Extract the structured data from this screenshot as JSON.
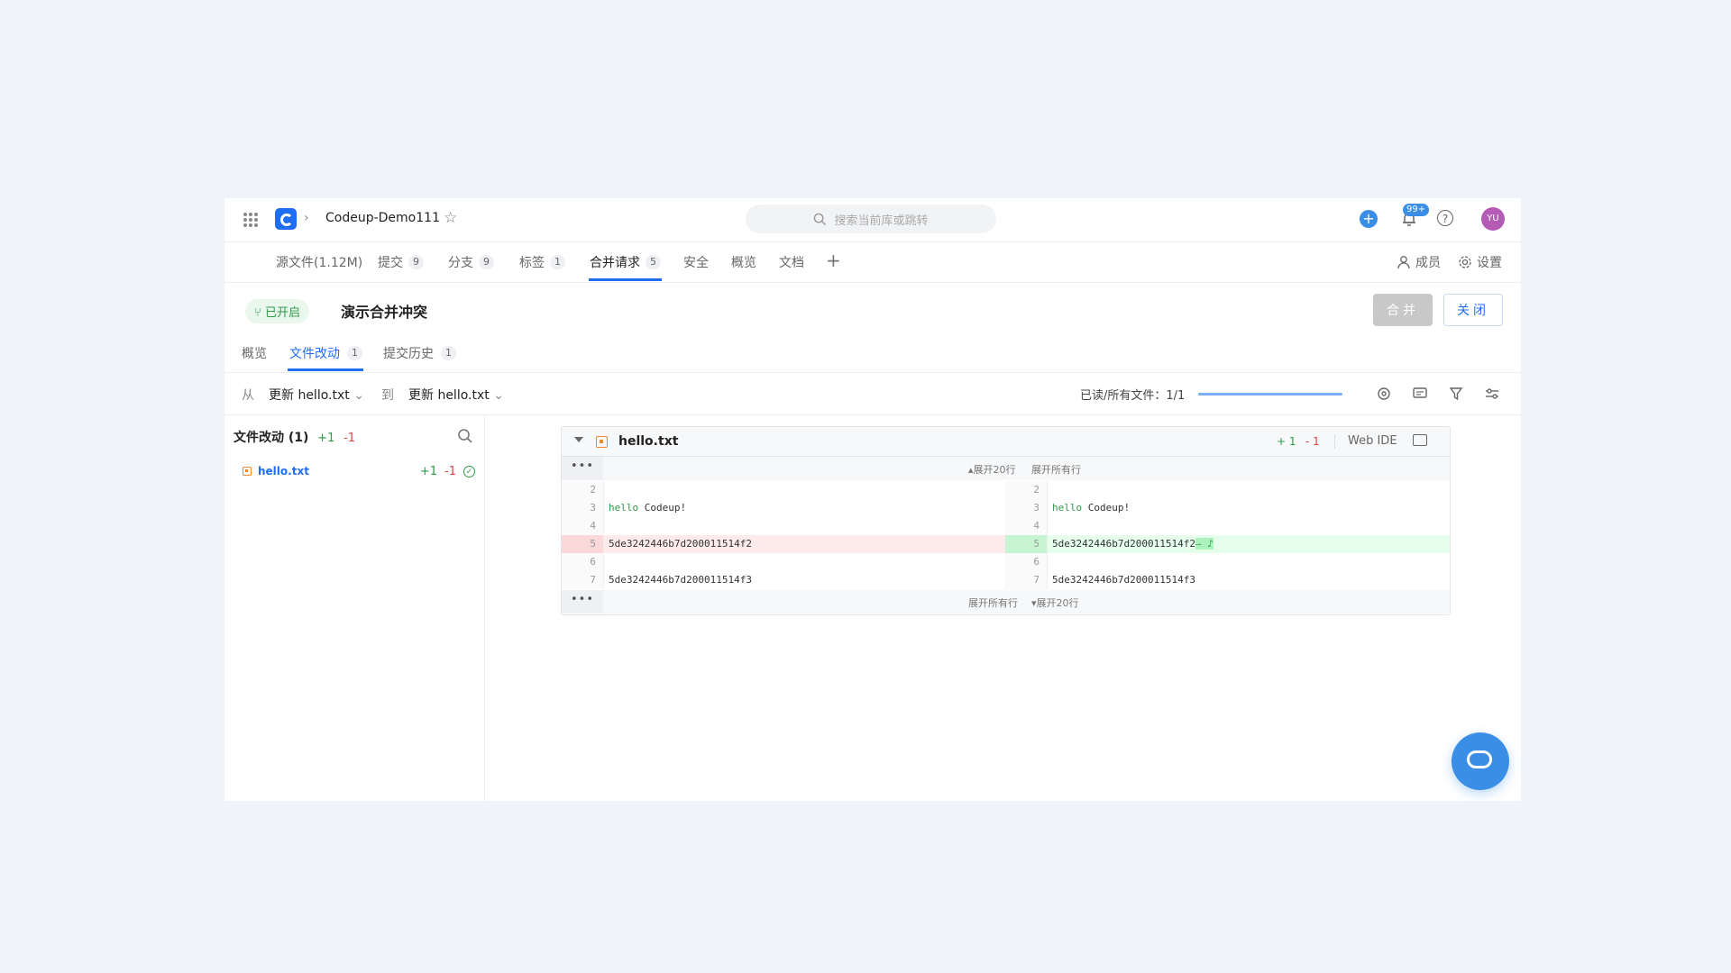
{
  "topbar": {
    "repo_name": "Codeup-Demo111",
    "search_placeholder": "搜索当前库或跳转",
    "notif_badge": "99+",
    "avatar": "YU",
    "help_glyph": "?"
  },
  "nav": {
    "items": [
      {
        "label": "源文件(1.12M)",
        "badge": ""
      },
      {
        "label": "提交",
        "badge": "9"
      },
      {
        "label": "分支",
        "badge": "9"
      },
      {
        "label": "标签",
        "badge": "1"
      },
      {
        "label": "合并请求",
        "badge": "5"
      },
      {
        "label": "安全",
        "badge": ""
      },
      {
        "label": "概览",
        "badge": ""
      },
      {
        "label": "文档",
        "badge": ""
      }
    ],
    "add_label": "+",
    "members": "成员",
    "settings": "设置"
  },
  "mr": {
    "status": "已开启",
    "title": "演示合并冲突",
    "merge_button": "合并",
    "close_button": "关闭",
    "subtabs": [
      {
        "label": "概览",
        "badge": ""
      },
      {
        "label": "文件改动",
        "badge": "1"
      },
      {
        "label": "提交历史",
        "badge": "1"
      }
    ]
  },
  "compare": {
    "from_label": "从",
    "from_value": "更新 hello.txt",
    "to_label": "到",
    "to_value": "更新 hello.txt",
    "progress_label": "已读/所有文件：1/1",
    "progress": 1.0
  },
  "filetree": {
    "title": "文件改动 (1)",
    "add": "+1",
    "del": "-1",
    "file": {
      "name": "hello.txt",
      "add": "+1",
      "del": "-1"
    }
  },
  "diff": {
    "filename": "hello.txt",
    "add": "+ 1",
    "del": "- 1",
    "webide": "Web IDE",
    "expand_top": [
      "▴展开20行",
      "展开所有行"
    ],
    "expand_bottom": [
      "展开所有行",
      "▾展开20行"
    ],
    "dots": "•••",
    "rows": [
      {
        "ln": "2",
        "left": "",
        "right": ""
      },
      {
        "ln": "3",
        "left_kw": "hello",
        "left": " Codeup!",
        "right_kw": "hello",
        "right": " Codeup!"
      },
      {
        "ln": "4",
        "left": "",
        "right": ""
      },
      {
        "ln": "5",
        "left": "5de3242446b7d200011514f2",
        "right": "5de3242446b7d200011514f2",
        "right_inline": "— ♪"
      },
      {
        "ln": "6",
        "left": "",
        "right": ""
      },
      {
        "ln": "7",
        "left": "5de3242446b7d200011514f3",
        "right": "5de3242446b7d200011514f3"
      }
    ]
  },
  "colors": {
    "accent": "#1f6ef2",
    "add": "#2e9a47",
    "del": "#d94545"
  }
}
